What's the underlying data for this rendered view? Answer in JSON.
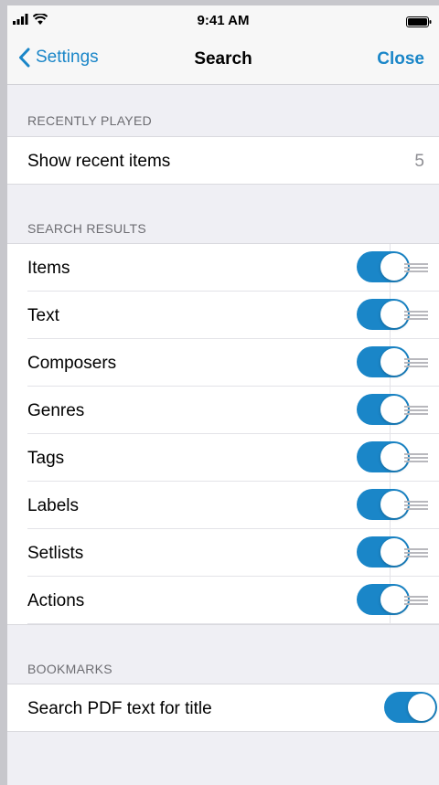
{
  "status_bar": {
    "time": "9:41 AM"
  },
  "nav": {
    "back_label": "Settings",
    "title": "Search",
    "close_label": "Close"
  },
  "recently_played": {
    "header": "RECENTLY PLAYED",
    "row_label": "Show recent items",
    "row_value": "5"
  },
  "search_results": {
    "header": "SEARCH RESULTS",
    "items": [
      {
        "label": "Items",
        "enabled": true
      },
      {
        "label": "Text",
        "enabled": true
      },
      {
        "label": "Composers",
        "enabled": true
      },
      {
        "label": "Genres",
        "enabled": true
      },
      {
        "label": "Tags",
        "enabled": true
      },
      {
        "label": "Labels",
        "enabled": true
      },
      {
        "label": "Setlists",
        "enabled": true
      },
      {
        "label": "Actions",
        "enabled": true
      }
    ]
  },
  "bookmarks": {
    "header": "BOOKMARKS",
    "row_label": "Search PDF text for title",
    "enabled": true
  },
  "colors": {
    "accent": "#1a86c8",
    "background": "#efeff4",
    "secondary_text": "#6d6d72"
  }
}
